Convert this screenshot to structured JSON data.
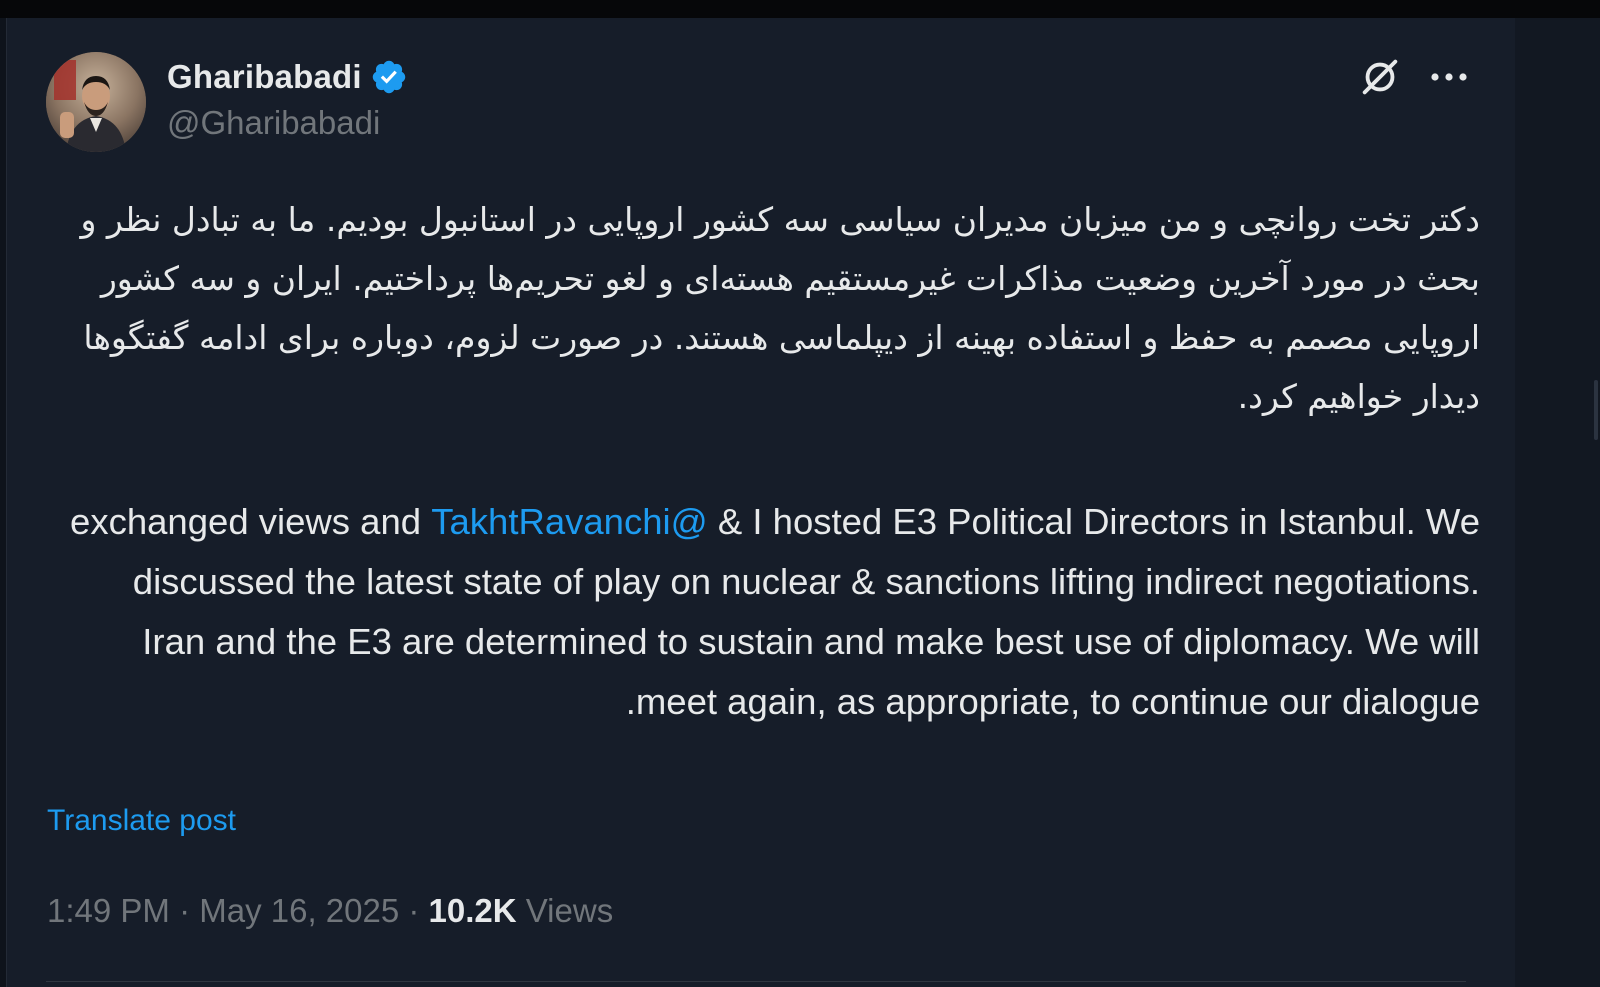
{
  "author": {
    "display_name": "Gharibabadi",
    "handle": "@Gharibabadi",
    "verified": true,
    "verified_color": "#1d9bf0"
  },
  "post": {
    "persian_text": "دکتر تخت روانچی و من میزبان مدیران سیاسی سه کشور اروپایی در استانبول بودیم. ما به تبادل نظر و بحث در مورد آخرین وضعیت مذاکرات غیرمستقیم هسته‌ای و لغو تحریم‌ها پرداختیم. ایران و سه کشور اروپایی مصمم به حفظ و استفاده بهینه از دیپلماسی هستند. در صورت لزوم، دوباره برای ادامه گفتگوها دیدار خواهیم کرد.",
    "english_before_mention": "I hosted E3 Political Directors in Istanbul. We & ",
    "english_mention": "@TakhtRavanchi",
    "english_after_mention": " exchanged views and discussed the latest state of play on nuclear & sanctions lifting indirect negotiations. Iran and the E3 are determined to sustain and make best use of diplomacy. We will meet again, as appropriate, to continue our dialogue."
  },
  "actions": {
    "translate_label": "Translate post",
    "grok_icon": "grok-icon",
    "more_icon": "more-options-icon"
  },
  "meta": {
    "time": "1:49 PM",
    "separator": " · ",
    "date": "May 16, 2025",
    "views_count": "10.2K",
    "views_label": " Views"
  },
  "colors": {
    "background": "#161d29",
    "text": "#e7e9ea",
    "secondary_text": "#71767b",
    "link": "#1d9bf0"
  }
}
